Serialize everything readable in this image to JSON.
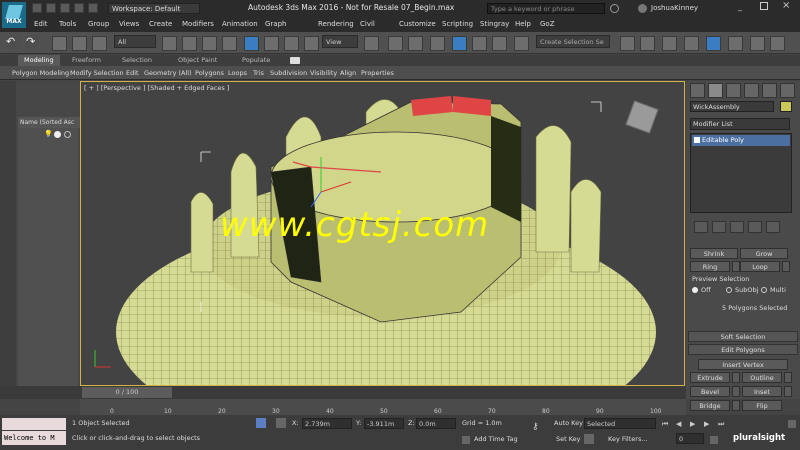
{
  "titlebar": {
    "logo_text": "MAX",
    "workspace": "Workspace: Default",
    "title": "Autodesk 3ds Max 2016 - Not for Resale   07_Begin.max",
    "search_placeholder": "Type a keyword or phrase",
    "user": "JoshuaKinney"
  },
  "menu": [
    "Edit",
    "Tools",
    "Group",
    "Views",
    "Create",
    "Modifiers",
    "Animation",
    "Graph Editors",
    "Rendering",
    "Civil View",
    "Customize",
    "Scripting",
    "Stingray",
    "Help",
    "GoZ"
  ],
  "toolbar": {
    "filter_value": "All",
    "refcoord_value": "View",
    "named_selection_placeholder": "Create Selection Se"
  },
  "ribbon": {
    "tabs": [
      "Modeling",
      "Freeform",
      "Selection",
      "Object Paint",
      "Populate"
    ],
    "active_tab": "Modeling",
    "items": [
      "Polygon Modeling",
      "Modify Selection",
      "Edit",
      "Geometry (All)",
      "Polygons",
      "Loops",
      "Tris",
      "Subdivision",
      "Visibility",
      "Align",
      "Properties"
    ]
  },
  "explorer": {
    "header": "Name (Sorted Asc"
  },
  "viewport": {
    "label": "[ + ] [Perspective ] [Shaded + Edged Faces ]",
    "watermark": "www.cgtsj.com"
  },
  "command_panel": {
    "object_name": "WickAssembly",
    "object_color": "#c8c85a",
    "modifier_list": "Modifier List",
    "stack_item": "Editable Poly",
    "shrink": "Shrink",
    "grow": "Grow",
    "ring": "Ring",
    "loop": "Loop",
    "preview_selection": "Preview Selection",
    "preview_off": "Off",
    "preview_subobj": "SubObj",
    "preview_multi": "Multi",
    "selected_info": "5 Polygons Selected",
    "soft_selection": "Soft Selection",
    "edit_polygons": "Edit Polygons",
    "insert_vertex": "Insert Vertex",
    "extrude": "Extrude",
    "outline": "Outline",
    "bevel": "Bevel",
    "inset": "Inset",
    "bridge": "Bridge",
    "flip": "Flip"
  },
  "timeline": {
    "slider": "0 / 100",
    "ticks": [
      "0",
      "10",
      "20",
      "30",
      "40",
      "50",
      "60",
      "70",
      "80",
      "90",
      "100"
    ]
  },
  "status": {
    "listener": "Welcome to M",
    "selection_info": "1 Object Selected",
    "prompt": "Click or click-and-drag to select objects",
    "x_label": "X:",
    "x_value": "2.739m",
    "y_label": "Y:",
    "y_value": "-3.911m",
    "z_label": "Z:",
    "z_value": "0.0m",
    "grid": "Grid = 1.0m",
    "add_time_tag": "Add Time Tag",
    "auto_key": "Auto Key",
    "key_mode": "Selected",
    "set_key": "Set Key",
    "key_filters": "Key Filters...",
    "frame": "0",
    "brand": "pluralsight"
  },
  "colors": {
    "viewport_border": "#d4b24a",
    "model": "#d8dd94",
    "selection": "#e04040",
    "watermark": "#ffff00"
  }
}
